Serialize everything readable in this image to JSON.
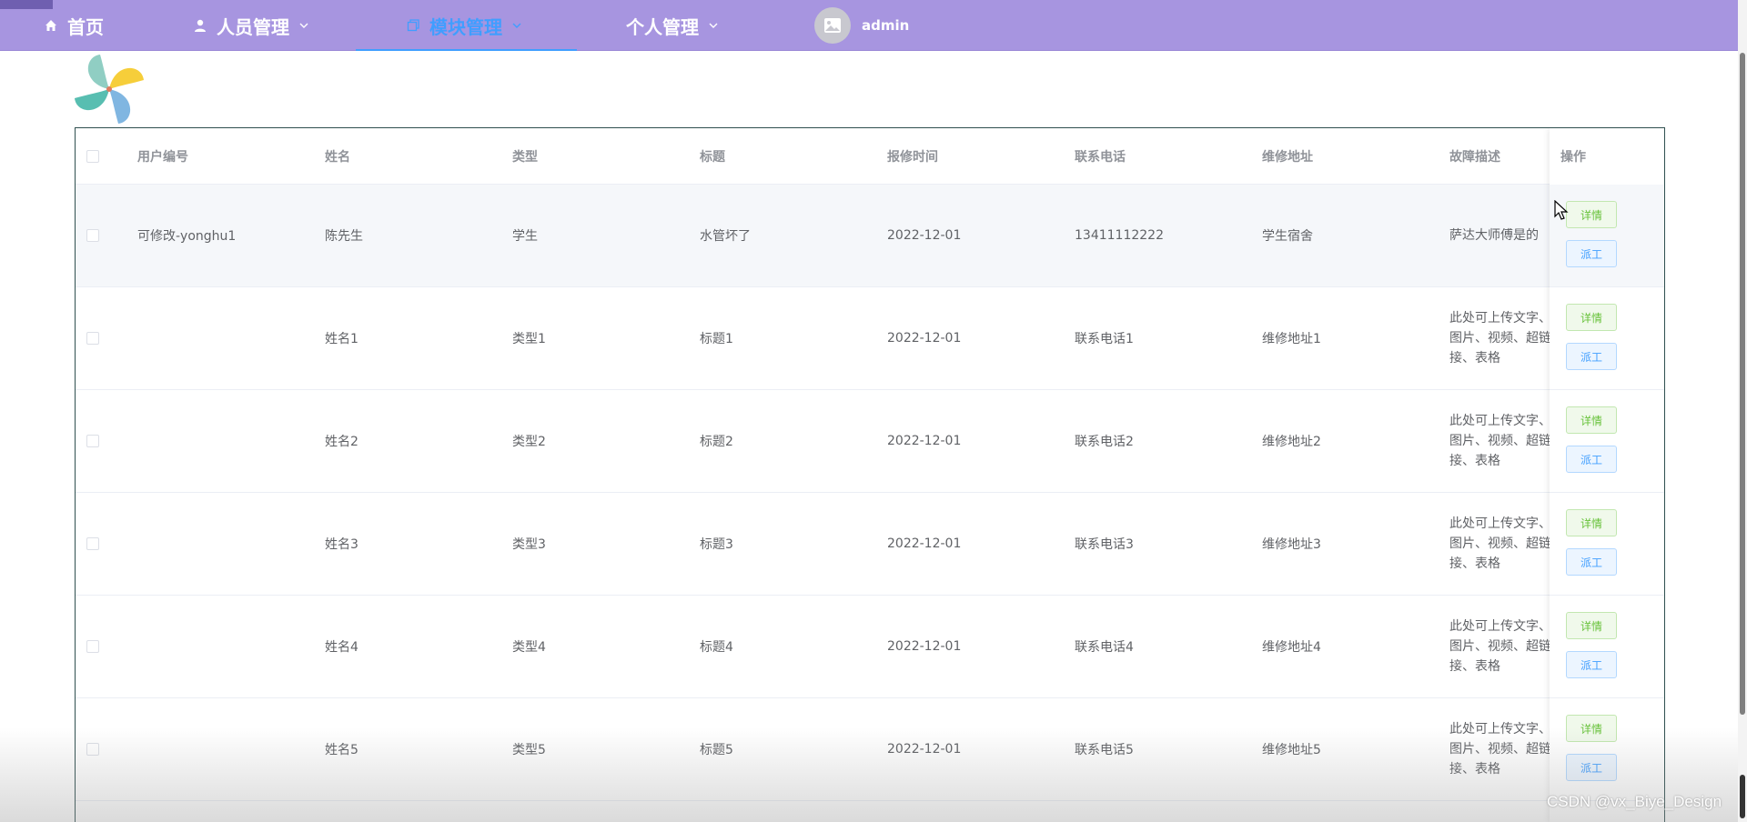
{
  "nav": {
    "items": [
      {
        "label": "首页",
        "icon": "home-icon"
      },
      {
        "label": "人员管理",
        "icon": "user-icon"
      },
      {
        "label": "模块管理",
        "icon": "module-icon"
      },
      {
        "label": "个人管理"
      }
    ],
    "username": "admin"
  },
  "table": {
    "columns": [
      "用户编号",
      "姓名",
      "类型",
      "标题",
      "报修时间",
      "联系电话",
      "维修地址",
      "故障描述"
    ],
    "ops_header": "操作",
    "detail_label": "详情",
    "dispatch_label": "派工",
    "rows": [
      {
        "uid": "可修改-yonghu1",
        "name": "陈先生",
        "type": "学生",
        "title": "水管坏了",
        "time": "2022-12-01",
        "phone": "13411112222",
        "address": "学生宿舍",
        "desc": "萨达大师傅是的"
      },
      {
        "uid": "",
        "name": "姓名1",
        "type": "类型1",
        "title": "标题1",
        "time": "2022-12-01",
        "phone": "联系电话1",
        "address": "维修地址1",
        "desc": "此处可上传文字、图片、视频、超链接、表格"
      },
      {
        "uid": "",
        "name": "姓名2",
        "type": "类型2",
        "title": "标题2",
        "time": "2022-12-01",
        "phone": "联系电话2",
        "address": "维修地址2",
        "desc": "此处可上传文字、图片、视频、超链接、表格"
      },
      {
        "uid": "",
        "name": "姓名3",
        "type": "类型3",
        "title": "标题3",
        "time": "2022-12-01",
        "phone": "联系电话3",
        "address": "维修地址3",
        "desc": "此处可上传文字、图片、视频、超链接、表格"
      },
      {
        "uid": "",
        "name": "姓名4",
        "type": "类型4",
        "title": "标题4",
        "time": "2022-12-01",
        "phone": "联系电话4",
        "address": "维修地址4",
        "desc": "此处可上传文字、图片、视频、超链接、表格"
      },
      {
        "uid": "",
        "name": "姓名5",
        "type": "类型5",
        "title": "标题5",
        "time": "2022-12-01",
        "phone": "联系电话5",
        "address": "维修地址5",
        "desc": "此处可上传文字、图片、视频、超链接、表格"
      }
    ]
  },
  "watermark": "CSDN @vx_Biye_Design",
  "colors": {
    "nav_bg": "#a795e0",
    "active": "#409eff",
    "detail": "#67c23a",
    "dispatch": "#409eff"
  }
}
